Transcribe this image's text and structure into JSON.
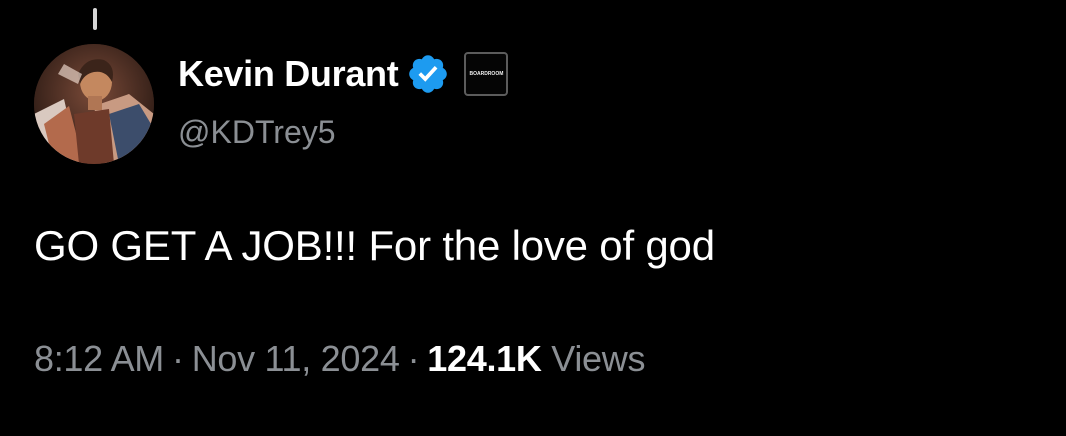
{
  "tweet": {
    "author": {
      "display_name": "Kevin Durant",
      "handle": "@KDTrey5",
      "verified": true,
      "verified_color": "#1d9bf0",
      "avatar_icon": "profile-photo",
      "affiliate_badge_text": "BOARDROOM"
    },
    "text": "GO GET A JOB!!! For the love of god",
    "meta": {
      "time": "8:12 AM",
      "separator": "·",
      "date": "Nov 11, 2024",
      "views_count": "124.1K",
      "views_label": "Views"
    }
  },
  "colors": {
    "background": "#000000",
    "primary_text": "#ffffff",
    "secondary_text": "#8b8f94",
    "accent": "#1d9bf0"
  }
}
